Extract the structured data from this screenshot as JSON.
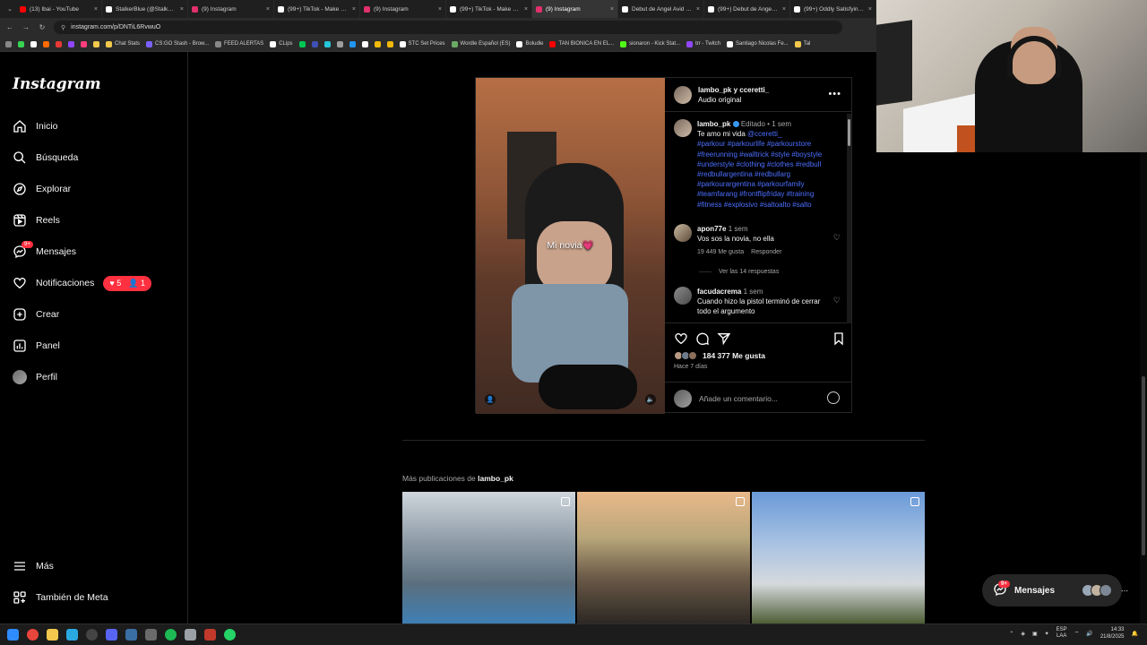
{
  "browser": {
    "tabs": [
      {
        "title": "(13) Ibai - YouTube",
        "color": "#ff0000"
      },
      {
        "title": "StalkerBlue (@Stalker...",
        "color": "#ffffff"
      },
      {
        "title": "(9) Instagram",
        "color": "#e1306c"
      },
      {
        "title": "(99+) TikTok - Make Yo...",
        "color": "#ffffff"
      },
      {
        "title": "(9) Instagram",
        "color": "#e1306c"
      },
      {
        "title": "(99+) TikTok - Make Yo...",
        "color": "#ffffff"
      },
      {
        "title": "(9) Instagram",
        "color": "#e1306c",
        "active": true
      },
      {
        "title": "Debut de Angel Avid c...",
        "color": "#ffffff"
      },
      {
        "title": "(99+) Debut de Angel A...",
        "color": "#ffffff"
      },
      {
        "title": "(99+) Oddly Satisfying...",
        "color": "#ffffff"
      }
    ],
    "url": "instagram.com/p/DNTiL6RvwuO",
    "bookmarks": [
      {
        "label": "",
        "color": "#39d353"
      },
      {
        "label": "",
        "color": "#ffffff"
      },
      {
        "label": "",
        "color": "#ff6a00"
      },
      {
        "label": "",
        "color": "#e53935"
      },
      {
        "label": "",
        "color": "#9146ff"
      },
      {
        "label": "",
        "color": "#ff3d7f"
      },
      {
        "label": "",
        "color": "#f2c94c"
      },
      {
        "label": "Chat Stats",
        "color": "#f2c94c"
      },
      {
        "label": "CS:GO Stash - Brow...",
        "color": "#7b61ff"
      },
      {
        "label": "FEED ALERTAS",
        "color": "#888888"
      },
      {
        "label": "CLips",
        "color": "#ffffff"
      },
      {
        "label": "",
        "color": "#00c853"
      },
      {
        "label": "",
        "color": "#3f51b5"
      },
      {
        "label": "",
        "color": "#26c6da"
      },
      {
        "label": "",
        "color": "#9e9e9e"
      },
      {
        "label": "",
        "color": "#2196f3"
      },
      {
        "label": "",
        "color": "#ffffff"
      },
      {
        "label": "",
        "color": "#f0b90b"
      },
      {
        "label": "",
        "color": "#f0b90b"
      },
      {
        "label": "STC Set Prices",
        "color": "#ffffff"
      },
      {
        "label": "Wordle Español (ES)",
        "color": "#6aaa64"
      },
      {
        "label": "Boludle",
        "color": "#ffffff"
      },
      {
        "label": "TAN BIONICA EN EL...",
        "color": "#ff0000"
      },
      {
        "label": "sionaron - Kick Stat...",
        "color": "#53fc18"
      },
      {
        "label": "trr - Twitch",
        "color": "#9146ff"
      },
      {
        "label": "Santiago Nicolas Fe...",
        "color": "#ffffff"
      },
      {
        "label": "Tal",
        "color": "#f2c94c"
      }
    ]
  },
  "sidebar": {
    "logo": "Instagram",
    "items": [
      {
        "label": "Inicio",
        "icon": "home-icon"
      },
      {
        "label": "Búsqueda",
        "icon": "search-icon"
      },
      {
        "label": "Explorar",
        "icon": "compass-icon"
      },
      {
        "label": "Reels",
        "icon": "reels-icon"
      },
      {
        "label": "Mensajes",
        "icon": "messenger-icon",
        "badge": "9+"
      },
      {
        "label": "Notificaciones",
        "icon": "heart-icon",
        "likes": "5",
        "follows": "1"
      },
      {
        "label": "Crear",
        "icon": "plus-square-icon"
      },
      {
        "label": "Panel",
        "icon": "chart-icon"
      },
      {
        "label": "Perfil",
        "icon": "avatar"
      }
    ],
    "bottom": [
      {
        "label": "Más",
        "icon": "menu-icon"
      },
      {
        "label": "También de Meta",
        "icon": "meta-grid-icon"
      }
    ]
  },
  "post": {
    "overlay_text": "Mi novia💗",
    "header_users": "lambo_pk y cceretti_",
    "header_audio": "Audio original",
    "caption": {
      "user": "lambo_pk",
      "edited": "Editado",
      "time": "1 sem",
      "text": "Te amo mi vida",
      "mention": "@cceretti_",
      "hashtags": "#parkour #parkourlife #parkourstore #freerunning #walltrick #style #boystyle #understyle #clothing #clothes #redbull #redbullargentina #redbullarg #parkourargentina #parkourfamily #teamfarang #frontflipfriday #training #fitness #explosivo #saltoalto #salto"
    },
    "comments": [
      {
        "user": "apon77e",
        "time": "1 sem",
        "text": "Vos sos la novia, no ella",
        "likes": "19 449 Me gusta",
        "reply": "Responder",
        "view_replies": "Ver las 14 respuestas"
      },
      {
        "user": "facudacrema",
        "time": "1 sem",
        "text": "Cuando hizo la pistol terminó de cerrar todo el argumento"
      }
    ],
    "likes": "184 377 Me gusta",
    "date": "Hace 7 días",
    "add_comment_placeholder": "Añade un comentario..."
  },
  "more": {
    "prefix": "Más publicaciones de",
    "user": "lambo_pk"
  },
  "floating_messages": {
    "label": "Mensajes",
    "badge": "9+"
  },
  "tray": {
    "lang1": "ESP",
    "lang2": "LAA",
    "time": "14:33",
    "date": "21/8/2025"
  }
}
